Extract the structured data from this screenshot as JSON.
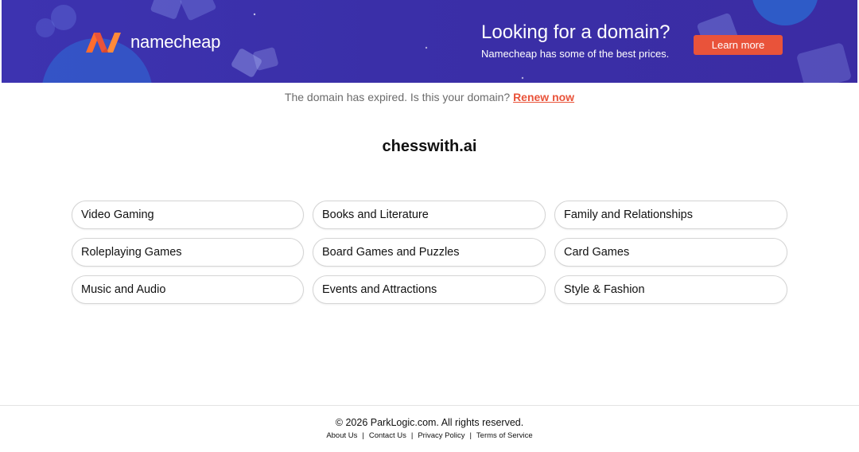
{
  "banner": {
    "logo_text": "namecheap",
    "title": "Looking for a domain?",
    "subtitle": "Namecheap has some of the best prices.",
    "button_label": "Learn more",
    "colors": {
      "background": "#3b30aa",
      "accent": "#e9533a"
    }
  },
  "notice": {
    "text": "The domain has expired. Is this your domain?",
    "link_label": "Renew now"
  },
  "domain": "chesswith.ai",
  "categories": [
    "Video Gaming",
    "Books and Literature",
    "Family and Relationships",
    "Roleplaying Games",
    "Board Games and Puzzles",
    "Card Games",
    "Music and Audio",
    "Events and Attractions",
    "Style & Fashion"
  ],
  "footer": {
    "copyright": "© 2026 ParkLogic.com. All rights reserved.",
    "links": [
      "About Us",
      "Contact Us",
      "Privacy Policy",
      "Terms of Service"
    ]
  }
}
